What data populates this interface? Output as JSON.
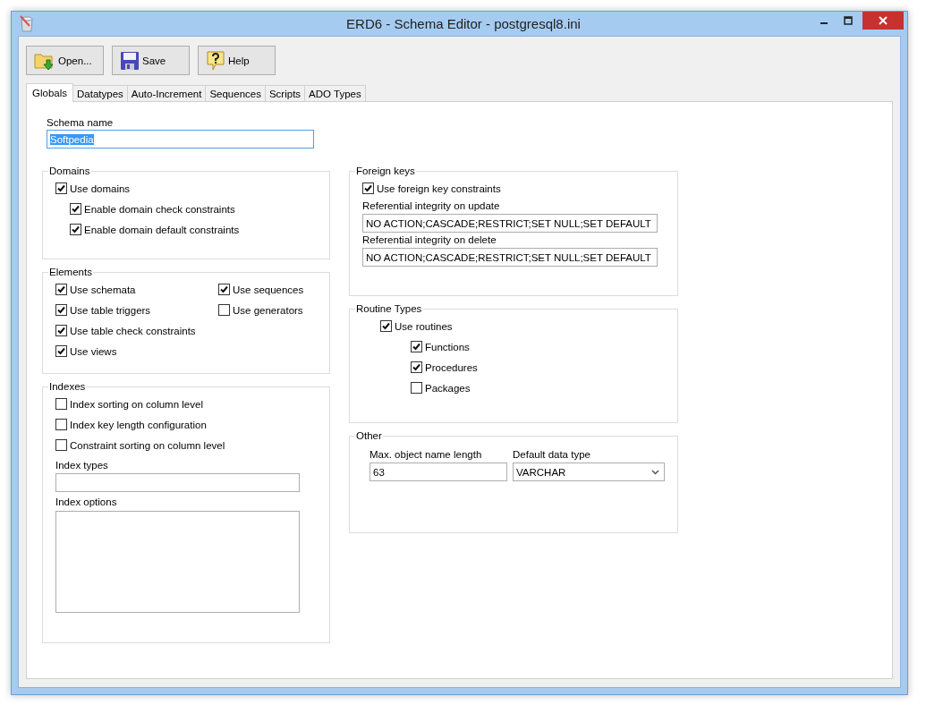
{
  "window": {
    "title": "ERD6 - Schema Editor - postgresql8.ini"
  },
  "toolbar": [
    {
      "label": "Open...",
      "kind": "open"
    },
    {
      "label": "Save",
      "kind": "save"
    },
    {
      "label": "Help",
      "kind": "help"
    }
  ],
  "tabs": [
    {
      "label": "Globals",
      "selected": true
    },
    {
      "label": "Datatypes",
      "selected": false
    },
    {
      "label": "Auto-Increment",
      "selected": false
    },
    {
      "label": "Sequences",
      "selected": false
    },
    {
      "label": "Scripts",
      "selected": false
    },
    {
      "label": "ADO Types",
      "selected": false
    }
  ],
  "schema_name": {
    "label": "Schema name",
    "value": "Softpedia",
    "highlighted": true
  },
  "domains": {
    "title": "Domains",
    "options": [
      {
        "label": "Use domains",
        "checked": true,
        "children": [
          {
            "label": "Enable domain check constraints",
            "checked": true
          },
          {
            "label": "Enable domain default constraints",
            "checked": true
          }
        ]
      }
    ]
  },
  "elements": {
    "title": "Elements",
    "options": [
      {
        "label": "Use schemata",
        "checked": true
      },
      {
        "label": "Use table triggers",
        "checked": true
      },
      {
        "label": "Use table check constraints",
        "checked": true
      },
      {
        "label": "Use views",
        "checked": true
      },
      {
        "label": "Use sequences",
        "checked": true
      },
      {
        "label": "Use generators",
        "checked": false
      }
    ]
  },
  "indexes": {
    "title": "Indexes",
    "options": [
      {
        "label": "Index sorting on column level",
        "checked": false
      },
      {
        "label": "Index key length configuration",
        "checked": false
      },
      {
        "label": "Constraint sorting on column level",
        "checked": false
      }
    ],
    "fields": [
      {
        "label": "Index types",
        "kind": "line"
      },
      {
        "label": "Index options",
        "kind": "area"
      }
    ]
  },
  "foreign_keys": {
    "title": "Foreign keys",
    "options": [
      {
        "label": "Use foreign key constraints",
        "checked": true
      }
    ],
    "fields": [
      {
        "label": "Referential integrity on update",
        "value": "NO ACTION;CASCADE;RESTRICT;SET NULL;SET DEFAULT"
      },
      {
        "label": "Referential integrity on delete",
        "value": "NO ACTION;CASCADE;RESTRICT;SET NULL;SET DEFAULT"
      }
    ]
  },
  "routine_types": {
    "title": "Routine Types",
    "options": [
      {
        "label": "Use routines",
        "checked": true,
        "children": [
          {
            "label": "Functions",
            "checked": true
          },
          {
            "label": "Procedures",
            "checked": true
          },
          {
            "label": "Packages",
            "checked": false
          }
        ]
      }
    ]
  },
  "other": {
    "title": "Other",
    "fields": [
      {
        "label": "Max. object name length",
        "value": "63",
        "kind": "text"
      },
      {
        "label": "Default data type",
        "value": "VARCHAR",
        "kind": "select"
      }
    ]
  }
}
